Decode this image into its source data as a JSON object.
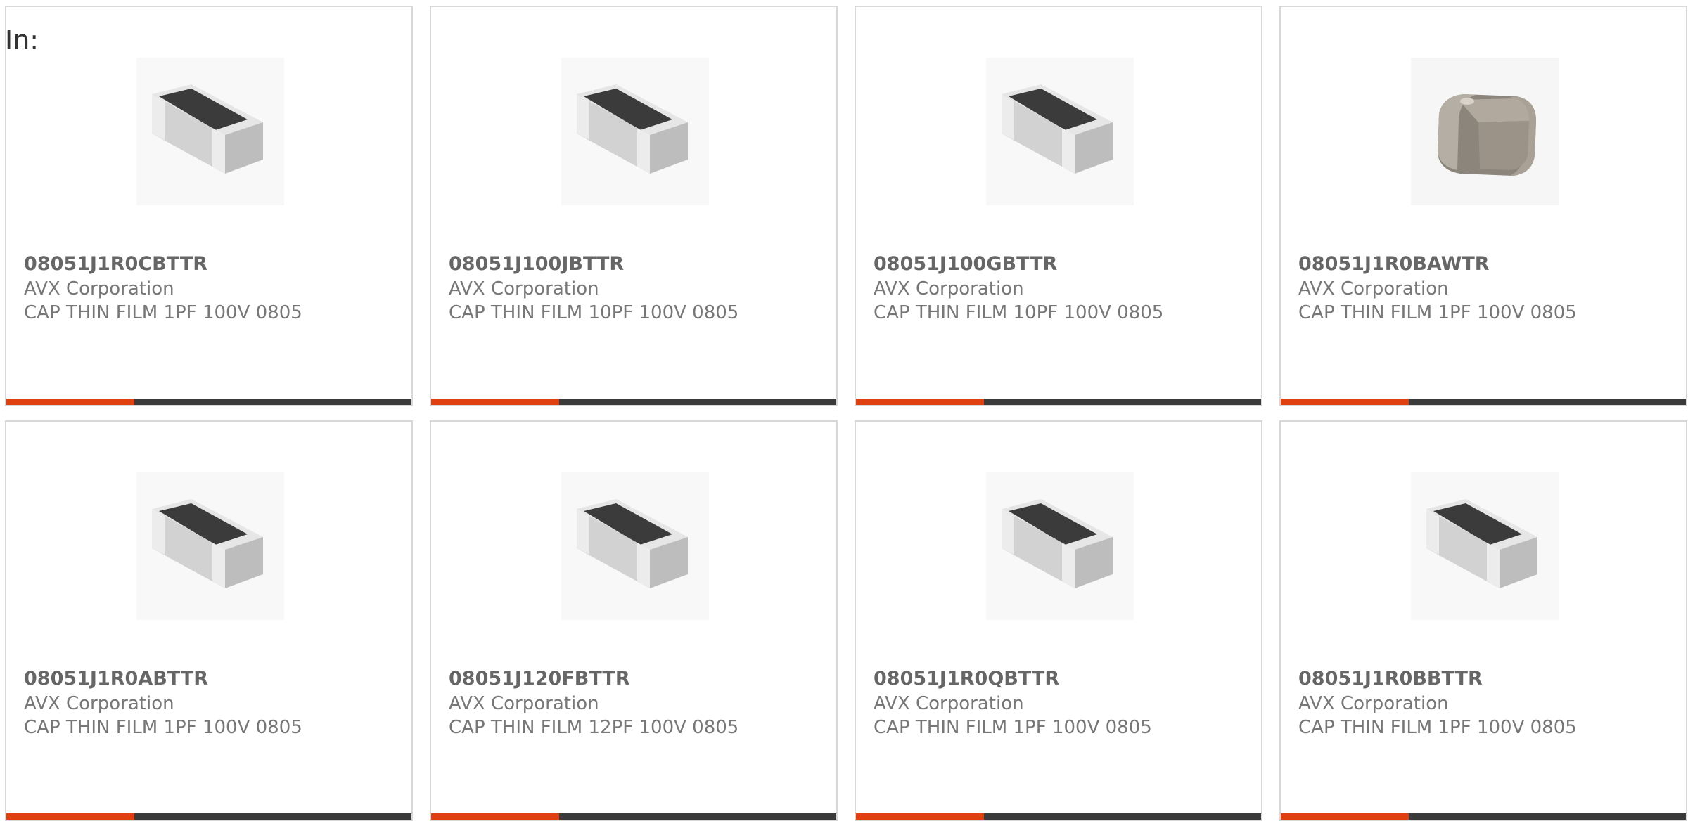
{
  "page": {
    "label": "In:"
  },
  "colors": {
    "accent": "#e0400f",
    "bar_dark": "#3a3a3a",
    "card_border": "#d8d8d8"
  },
  "products": [
    {
      "part_number": "08051J1R0CBTTR",
      "manufacturer": "AVX Corporation",
      "description": "CAP THIN FILM 1PF 100V 0805",
      "image": "chip-capacitor-thin-film"
    },
    {
      "part_number": "08051J100JBTTR",
      "manufacturer": "AVX Corporation",
      "description": "CAP THIN FILM 10PF 100V 0805",
      "image": "chip-capacitor-thin-film"
    },
    {
      "part_number": "08051J100GBTTR",
      "manufacturer": "AVX Corporation",
      "description": "CAP THIN FILM 10PF 100V 0805",
      "image": "chip-capacitor-thin-film"
    },
    {
      "part_number": "08051J1R0BAWTR",
      "manufacturer": "AVX Corporation",
      "description": "CAP THIN FILM 1PF 100V 0805",
      "image": "chip-capacitor-ceramic"
    },
    {
      "part_number": "08051J1R0ABTTR",
      "manufacturer": "AVX Corporation",
      "description": "CAP THIN FILM 1PF 100V 0805",
      "image": "chip-capacitor-thin-film"
    },
    {
      "part_number": "08051J120FBTTR",
      "manufacturer": "AVX Corporation",
      "description": "CAP THIN FILM 12PF 100V 0805",
      "image": "chip-capacitor-thin-film"
    },
    {
      "part_number": "08051J1R0QBTTR",
      "manufacturer": "AVX Corporation",
      "description": "CAP THIN FILM 1PF 100V 0805",
      "image": "chip-capacitor-thin-film"
    },
    {
      "part_number": "08051J1R0BBTTR",
      "manufacturer": "AVX Corporation",
      "description": "CAP THIN FILM 1PF 100V 0805",
      "image": "chip-capacitor-thin-film"
    }
  ]
}
